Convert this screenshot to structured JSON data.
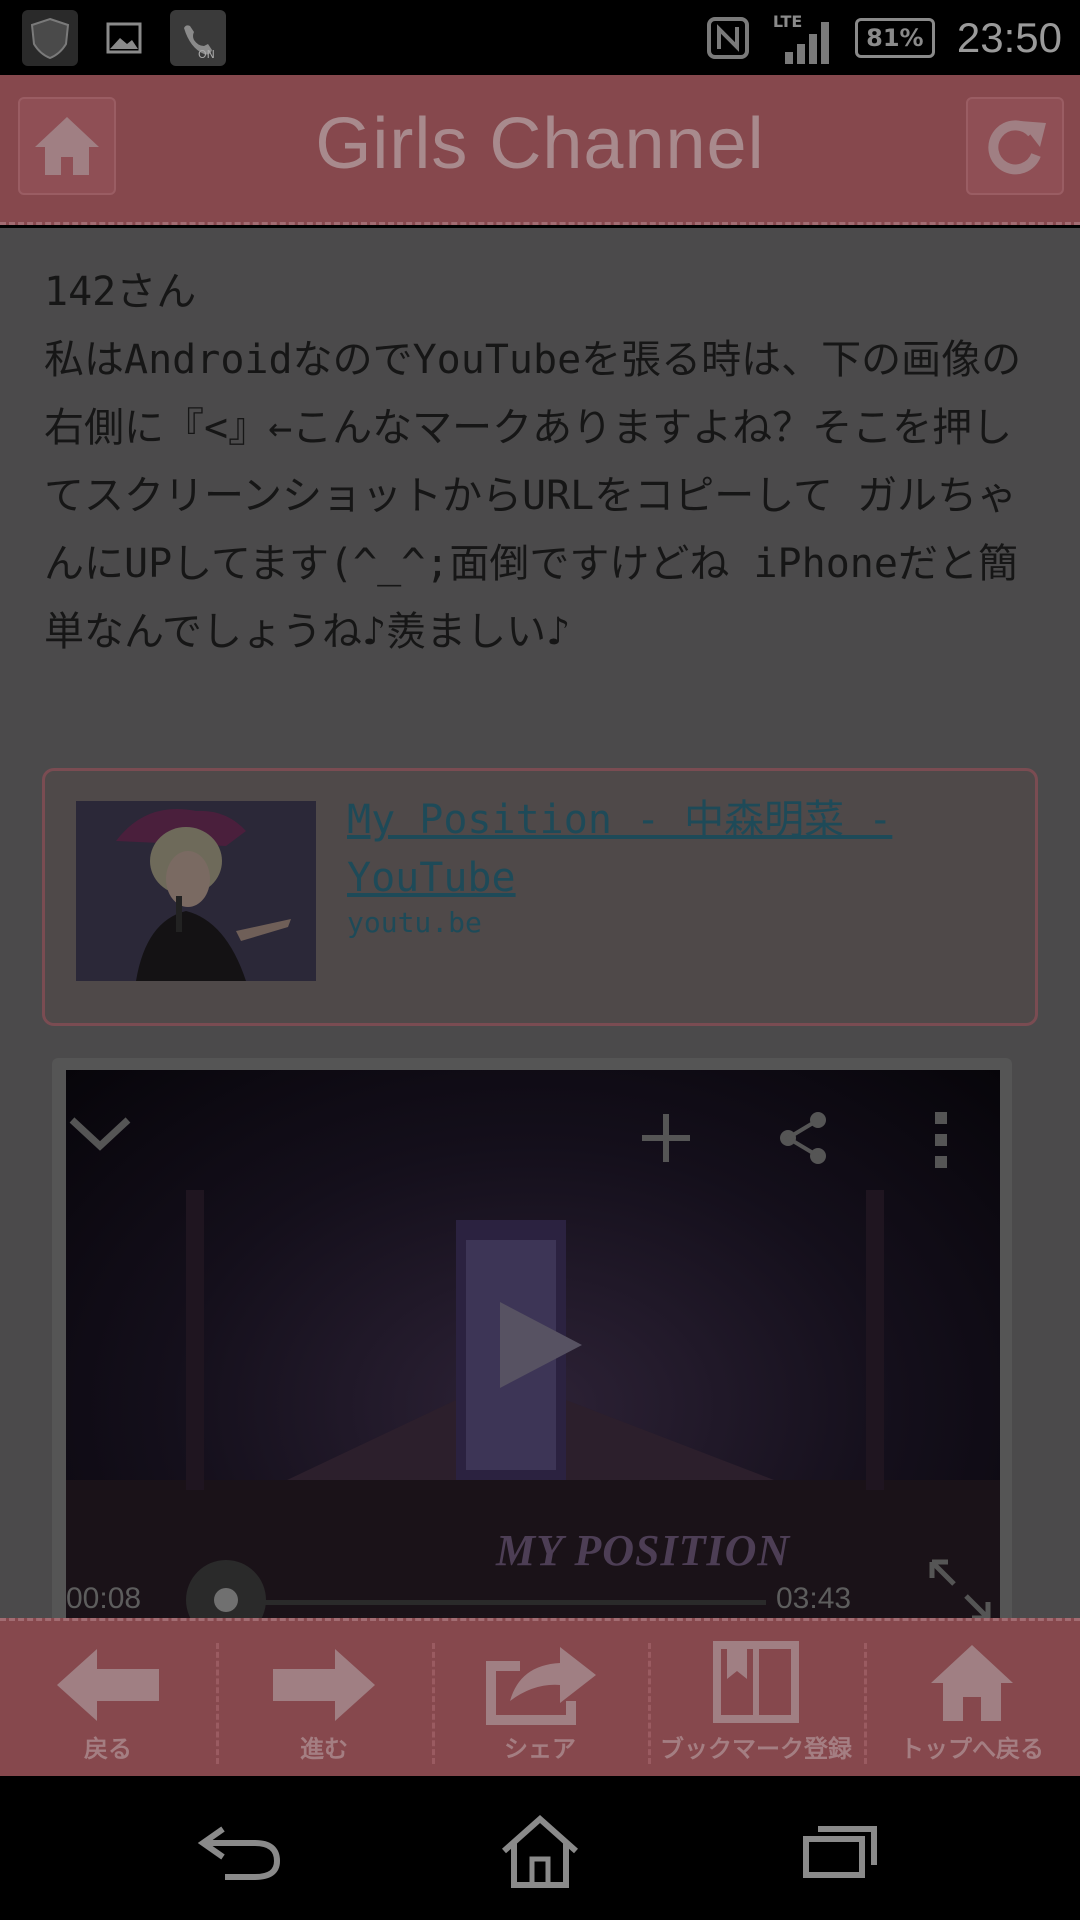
{
  "status_bar": {
    "network": "LTE",
    "battery": "81%",
    "time": "23:50",
    "icons": [
      "shield-icon",
      "image-icon",
      "wifi-calling-icon",
      "nfc-icon",
      "signal-icon",
      "battery-icon"
    ],
    "badge_on": "ON"
  },
  "header": {
    "title": "Girls Channel",
    "home_icon": "home-icon",
    "reload_icon": "reload-icon"
  },
  "comment": {
    "author": "142さん",
    "body": "私はAndroidなのでYouTubeを張る時は、下の画像の右側に『<』←こんなマークありますよね？そこを押してスクリーンショットからURLをコピーして ガルちゃんにUPしてます(^_^;面倒ですけどね iPhoneだと簡単なんでしょうね♪羨ましい♪"
  },
  "link_card": {
    "title": "My Position - 中森明菜 - YouTube",
    "domain": "youtu.be"
  },
  "video": {
    "elapsed": "00:08",
    "duration": "03:43",
    "overlay_text": "MY POSITION",
    "progress": 0.036
  },
  "toolbar": {
    "items": [
      {
        "label": "戻る",
        "icon": "arrow-left-icon"
      },
      {
        "label": "進む",
        "icon": "arrow-right-icon"
      },
      {
        "label": "シェア",
        "icon": "share-icon"
      },
      {
        "label": "ブックマーク登録",
        "icon": "bookmark-icon"
      },
      {
        "label": "トップへ戻る",
        "icon": "home-icon"
      }
    ]
  },
  "colors": {
    "header": "#86484d",
    "content_bg": "#4b4a4b",
    "link": "#1e4a58"
  }
}
